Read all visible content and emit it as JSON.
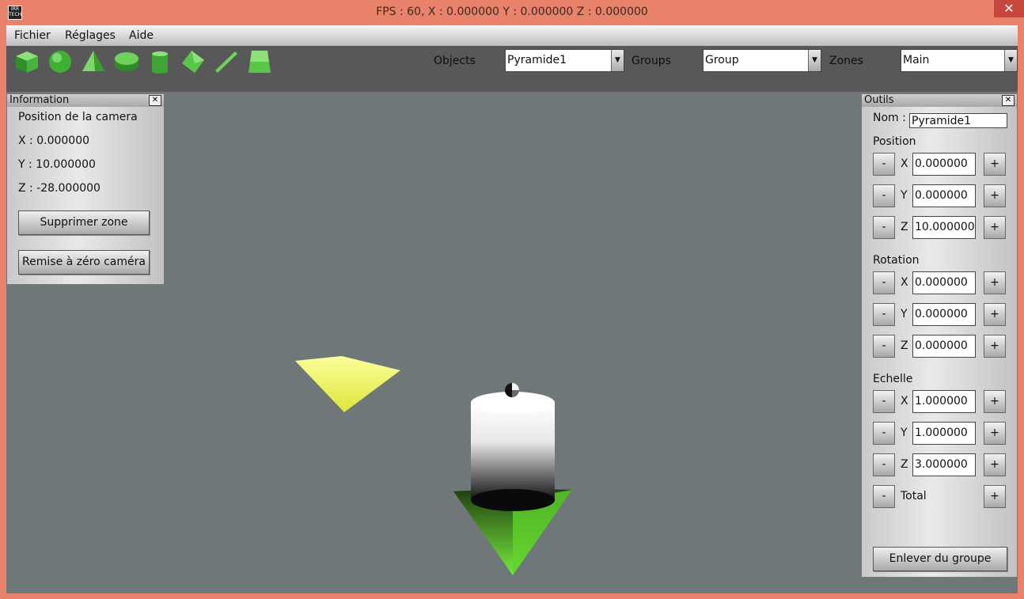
{
  "window": {
    "title": "FPS : 60, X : 0.000000 Y : 0.000000 Z : 0.000000",
    "app_icon_text": "IRR TECH",
    "close_glyph": "✕"
  },
  "menu": {
    "items": [
      "Fichier",
      "Réglages",
      "Aide"
    ]
  },
  "toolbar": {
    "tools": [
      {
        "name": "cube-tool",
        "icon": "cube-icon"
      },
      {
        "name": "sphere-tool",
        "icon": "sphere-icon"
      },
      {
        "name": "pyramid-tool",
        "icon": "pyramid-icon"
      },
      {
        "name": "disc-tool",
        "icon": "disc-icon"
      },
      {
        "name": "cylinder-tool",
        "icon": "cylinder-icon"
      },
      {
        "name": "plane-tool",
        "icon": "plane-icon"
      },
      {
        "name": "line-tool",
        "icon": "line-icon"
      },
      {
        "name": "trapezoid-tool",
        "icon": "trapezoid-icon"
      }
    ],
    "objects_label": "Objects",
    "objects_value": "Pyramide1",
    "groups_label": "Groups",
    "groups_value": "Group",
    "zones_label": "Zones",
    "zones_value": "Main",
    "accent_color": "#5cbf4a"
  },
  "info_panel": {
    "title": "Information",
    "camera_heading": "Position de la camera",
    "x_line": "X : 0.000000",
    "y_line": "Y : 10.000000",
    "z_line": "Z : -28.000000",
    "delete_zone_button": "Supprimer zone",
    "reset_camera_button": "Remise à zéro caméra"
  },
  "tools_panel": {
    "title": "Outils",
    "name_label": "Nom :",
    "name_value": "Pyramide1",
    "position_label": "Position",
    "position": {
      "x": "0.000000",
      "y": "0.000000",
      "z": "10.000000"
    },
    "rotation_label": "Rotation",
    "rotation": {
      "x": "0.000000",
      "y": "0.000000",
      "z": "0.000000"
    },
    "scale_label": "Echelle",
    "scale": {
      "x": "1.000000",
      "y": "1.000000",
      "z": "3.000000"
    },
    "total_label": "Total",
    "axis_x": "X",
    "axis_y": "Y",
    "axis_z": "Z",
    "minus": "-",
    "plus": "+",
    "remove_group_button": "Enlever du groupe"
  },
  "scene": {
    "background_color": "#6f7778",
    "yellow_color": "#f0f56a",
    "green_color": "#6fe03a"
  }
}
